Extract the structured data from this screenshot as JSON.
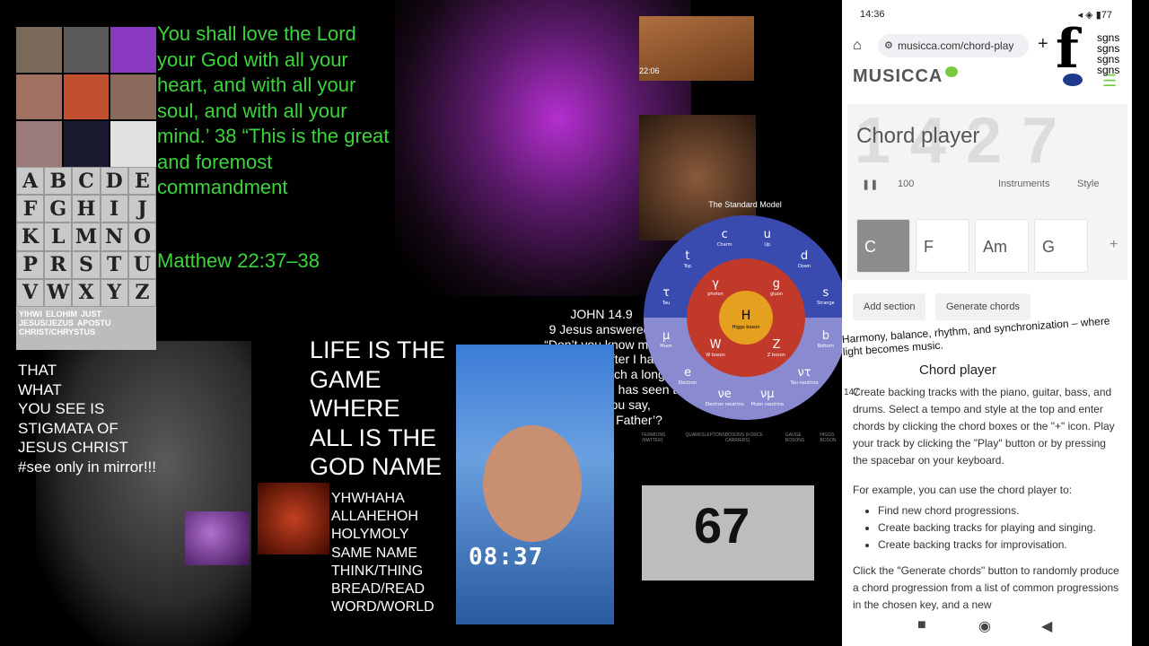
{
  "collage": {
    "alphabet": [
      "A",
      "B",
      "C",
      "D",
      "E",
      "F",
      "G",
      "H",
      "I",
      "J",
      "K",
      "L",
      "M",
      "N",
      "O",
      "P",
      "R",
      "S",
      "T",
      "U",
      "V",
      "W",
      "X",
      "Y",
      "Z"
    ],
    "names": [
      "YIHWI",
      "ELOHIM",
      "JUST",
      "JESUS/JEZUS",
      "APOSTU",
      "CHRIST/CHRYSTUS"
    ],
    "verse": "You shall love the Lord your God with all your heart, and with all your soul, and with all your mind.’ 38 “This is the great and foremost commandment",
    "verse_ref": "Matthew 22:37–38",
    "stigmata_lines": [
      "THAT",
      "WHAT",
      "YOU SEE IS",
      "STIGMATA OF",
      "JESUS CHRIST",
      "#see only in mirror!!!"
    ],
    "life_lines": [
      "LIFE IS THE",
      "GAME",
      "WHERE",
      "ALL IS THE",
      "GOD NAME"
    ],
    "word_lines": [
      "YHWHAHA",
      "ALLAHEHOH",
      "HOLYMOLY",
      "SAME  NAME",
      "THINK/THING",
      "BREAD/READ",
      "WORD/WORLD"
    ],
    "john_lines": [
      "JOHN 14.9",
      "9 Jesus answered:",
      "“Don’t you know me,",
      "Philip, even after I have",
      "been among you such a long time?",
      "Anyone who has seen me has seen the Father.",
      "How can you say,",
      "‘Show us the Father’?"
    ],
    "selfie_clock": "08:37",
    "rock_time": "22:06",
    "standard_model_title": "The Standard Model",
    "standard_model_legend": [
      "FERMIONS (MATTER)",
      "QUARKS",
      "LEPTONS",
      "BOSONS (FORCE CARRIERS)",
      "GAUGE BOSONS",
      "HIGGS BOSON"
    ],
    "book_number": "67",
    "particles": {
      "center": "H",
      "center_sub": "Higgs boson",
      "inner": [
        {
          "s": "γ",
          "n": "photon"
        },
        {
          "s": "g",
          "n": "gluon"
        },
        {
          "s": "Z",
          "n": "Z boson"
        },
        {
          "s": "W",
          "n": "W boson"
        }
      ],
      "outer": [
        {
          "s": "u",
          "n": "Up"
        },
        {
          "s": "d",
          "n": "Down"
        },
        {
          "s": "s",
          "n": "Strange"
        },
        {
          "s": "b",
          "n": "Bottom"
        },
        {
          "s": "ντ",
          "n": "Tau neutrino"
        },
        {
          "s": "νμ",
          "n": "Muon neutrino"
        },
        {
          "s": "νe",
          "n": "Electron neutrino"
        },
        {
          "s": "e",
          "n": "Electron"
        },
        {
          "s": "μ",
          "n": "Muon"
        },
        {
          "s": "τ",
          "n": "Tau"
        },
        {
          "s": "t",
          "n": "Top"
        },
        {
          "s": "c",
          "n": "Charm"
        }
      ]
    }
  },
  "phone": {
    "time": "14:36",
    "status_right": "◂ ◈ ▮77",
    "url": "musicca.com/chord-play",
    "logo": "MUSICCA",
    "big_digits": "1427",
    "title": "Chord player",
    "controls": {
      "play": "❚❚",
      "tempo": "100",
      "instruments": "Instruments",
      "style": "Style"
    },
    "chords": [
      "C",
      "F",
      "Am",
      "G"
    ],
    "add_chord": "+",
    "add_section": "Add section",
    "generate": "Generate chords",
    "banner": "Harmony, balance, rhythm, and synchronization – where light becomes music.",
    "subtitle": "Chord player",
    "num": "147",
    "p1": "Create backing tracks with the piano, guitar, bass, and drums. Select a tempo and style at the top and enter chords by clicking the chord boxes or the \"+\" icon. Play your track by clicking the \"Play\" button or by pressing the spacebar on your keyboard.",
    "p2": "For example, you can use the chord player to:",
    "list": [
      "Find new chord progressions.",
      "Create backing tracks for playing and singing.",
      "Create backing tracks for improvisation."
    ],
    "p3": "Click the \"Generate chords\" button to randomly produce a chord progression from a list of common progressions in the chosen key, and a new",
    "nav": [
      "■",
      "◉",
      "◀"
    ]
  },
  "overlay": {
    "fsgn": "f",
    "fsgn_small": [
      "sgns",
      "sgns",
      "sgns",
      "sgns"
    ]
  },
  "colors": {
    "verse_green": "#3bd43b",
    "musicca_green": "#7ac943",
    "sm_blue": "#3a4bb0",
    "sm_red": "#c0392b",
    "sm_orange": "#e6a020",
    "sm_lavender": "#8a8ad0"
  }
}
